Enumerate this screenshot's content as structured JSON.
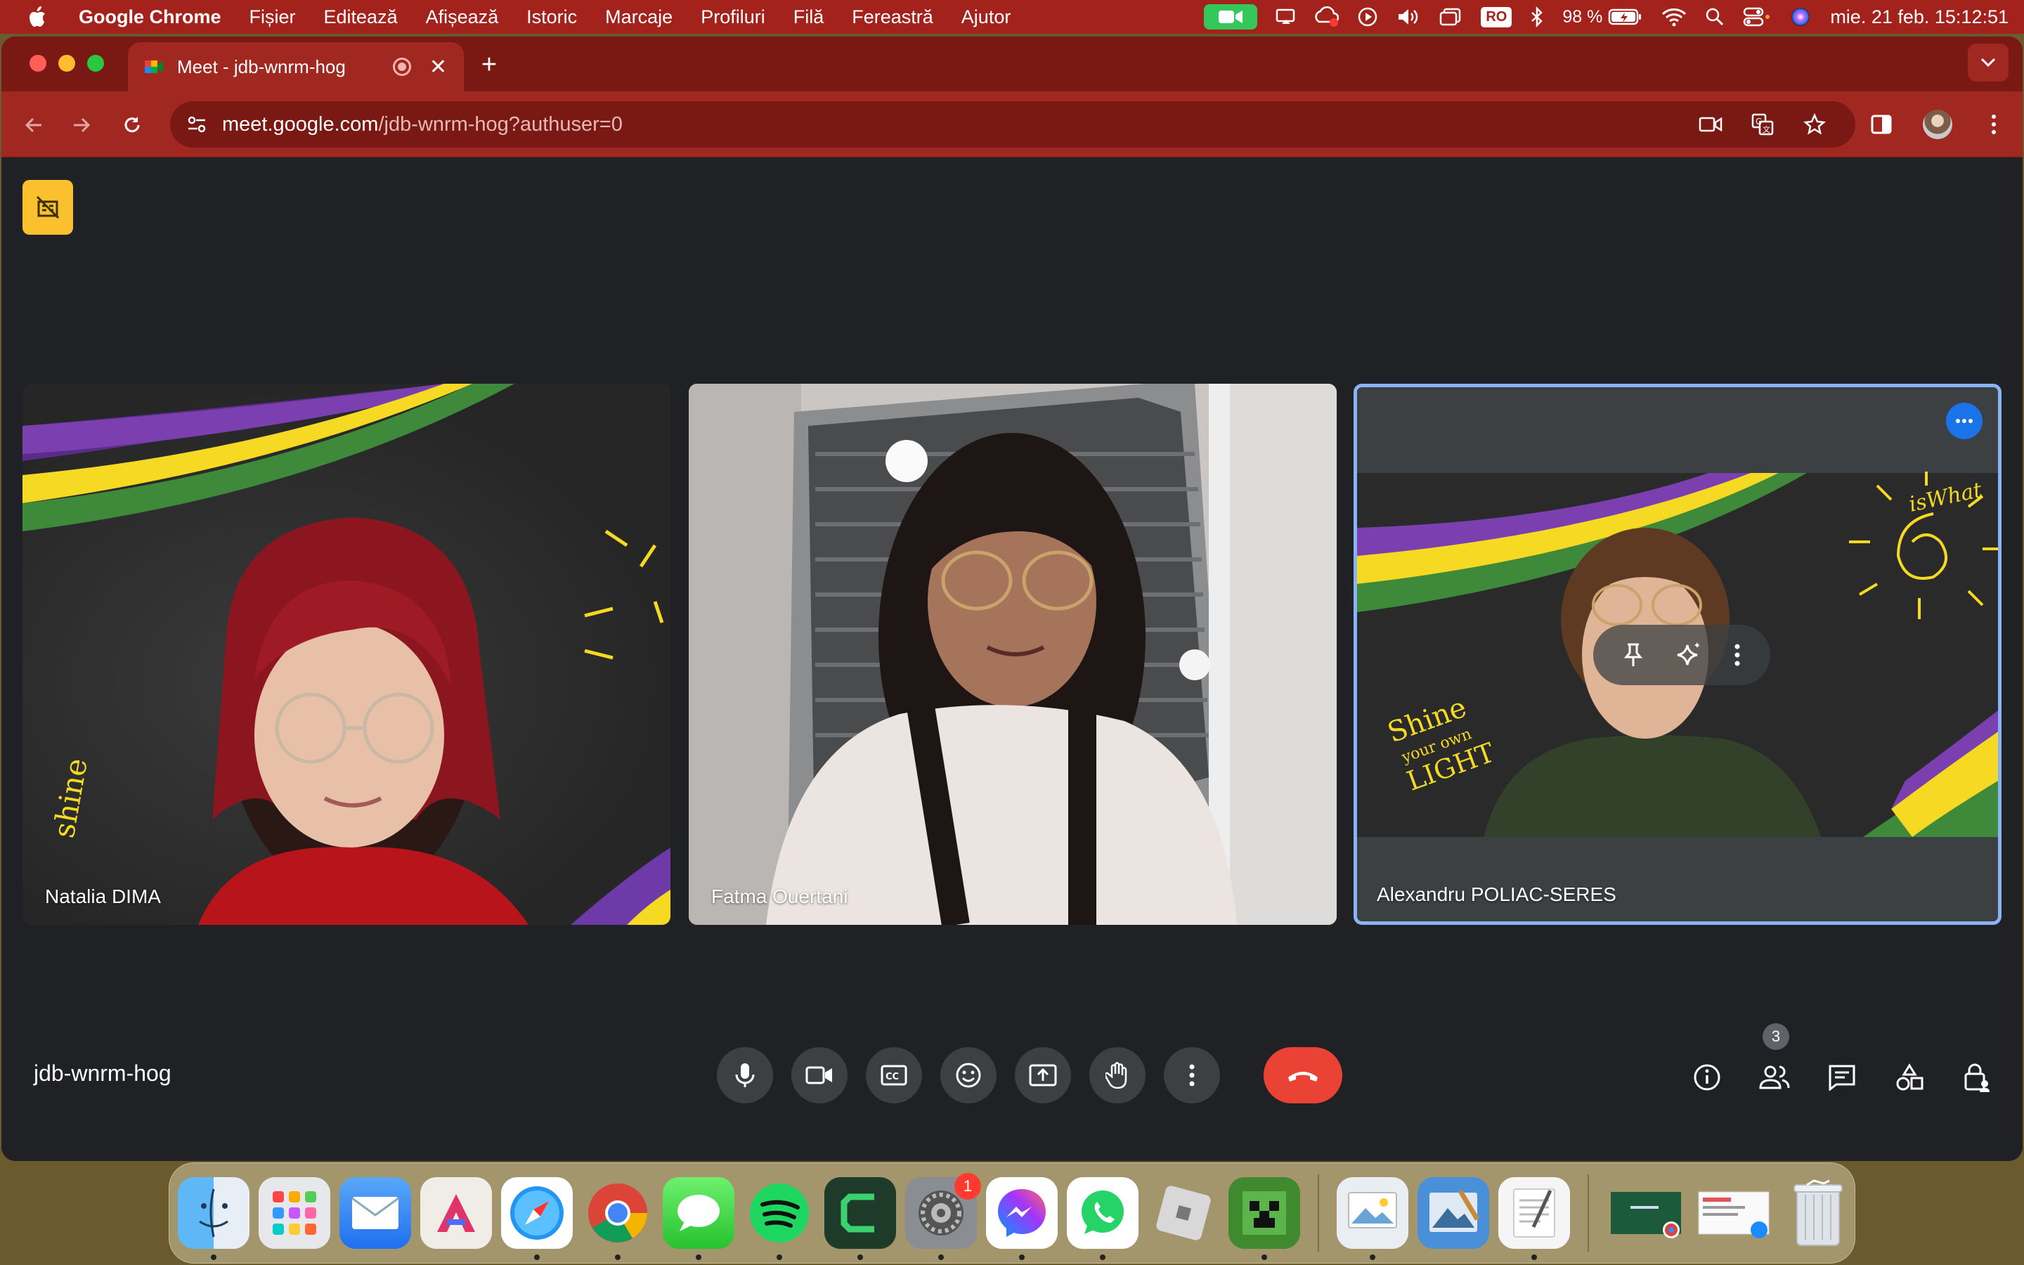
{
  "menubar": {
    "app_name": "Google Chrome",
    "menus": [
      "Fișier",
      "Editează",
      "Afișează",
      "Istoric",
      "Marcaje",
      "Profiluri",
      "Filă",
      "Fereastră",
      "Ajutor"
    ],
    "input_source": "RO",
    "battery": "98 %",
    "clock": "mie. 21 feb.  15:12:51"
  },
  "browser": {
    "tab_title": "Meet - jdb-wnrm-hog",
    "url_host": "meet.google.com",
    "url_path": "/jdb-wnrm-hog?authuser=0"
  },
  "meet": {
    "meeting_code": "jdb-wnrm-hog",
    "participant_count": "3",
    "participants": [
      {
        "name": "Natalia DIMA"
      },
      {
        "name": "Fatma Ouertani"
      },
      {
        "name": "Alexandru POLIAC-SERES"
      }
    ],
    "colors": {
      "accent": "#8ab4f8",
      "end_call": "#ea4335",
      "menubar": "#a3221b"
    }
  },
  "dock": {
    "apps": [
      "finder-icon",
      "launchpad-icon",
      "mail-icon",
      "affinity-icon",
      "safari-icon",
      "chrome-icon",
      "messages-icon",
      "spotify-icon",
      "camtasia-icon",
      "system-settings-icon",
      "messenger-icon",
      "whatsapp-icon",
      "roblox-icon",
      "minecraft-icon",
      "preview-icon",
      "image-capture-icon",
      "textedit-icon",
      "minimized-window-icon",
      "minimized-window-icon",
      "trash-icon"
    ],
    "settings_badge": "1"
  }
}
